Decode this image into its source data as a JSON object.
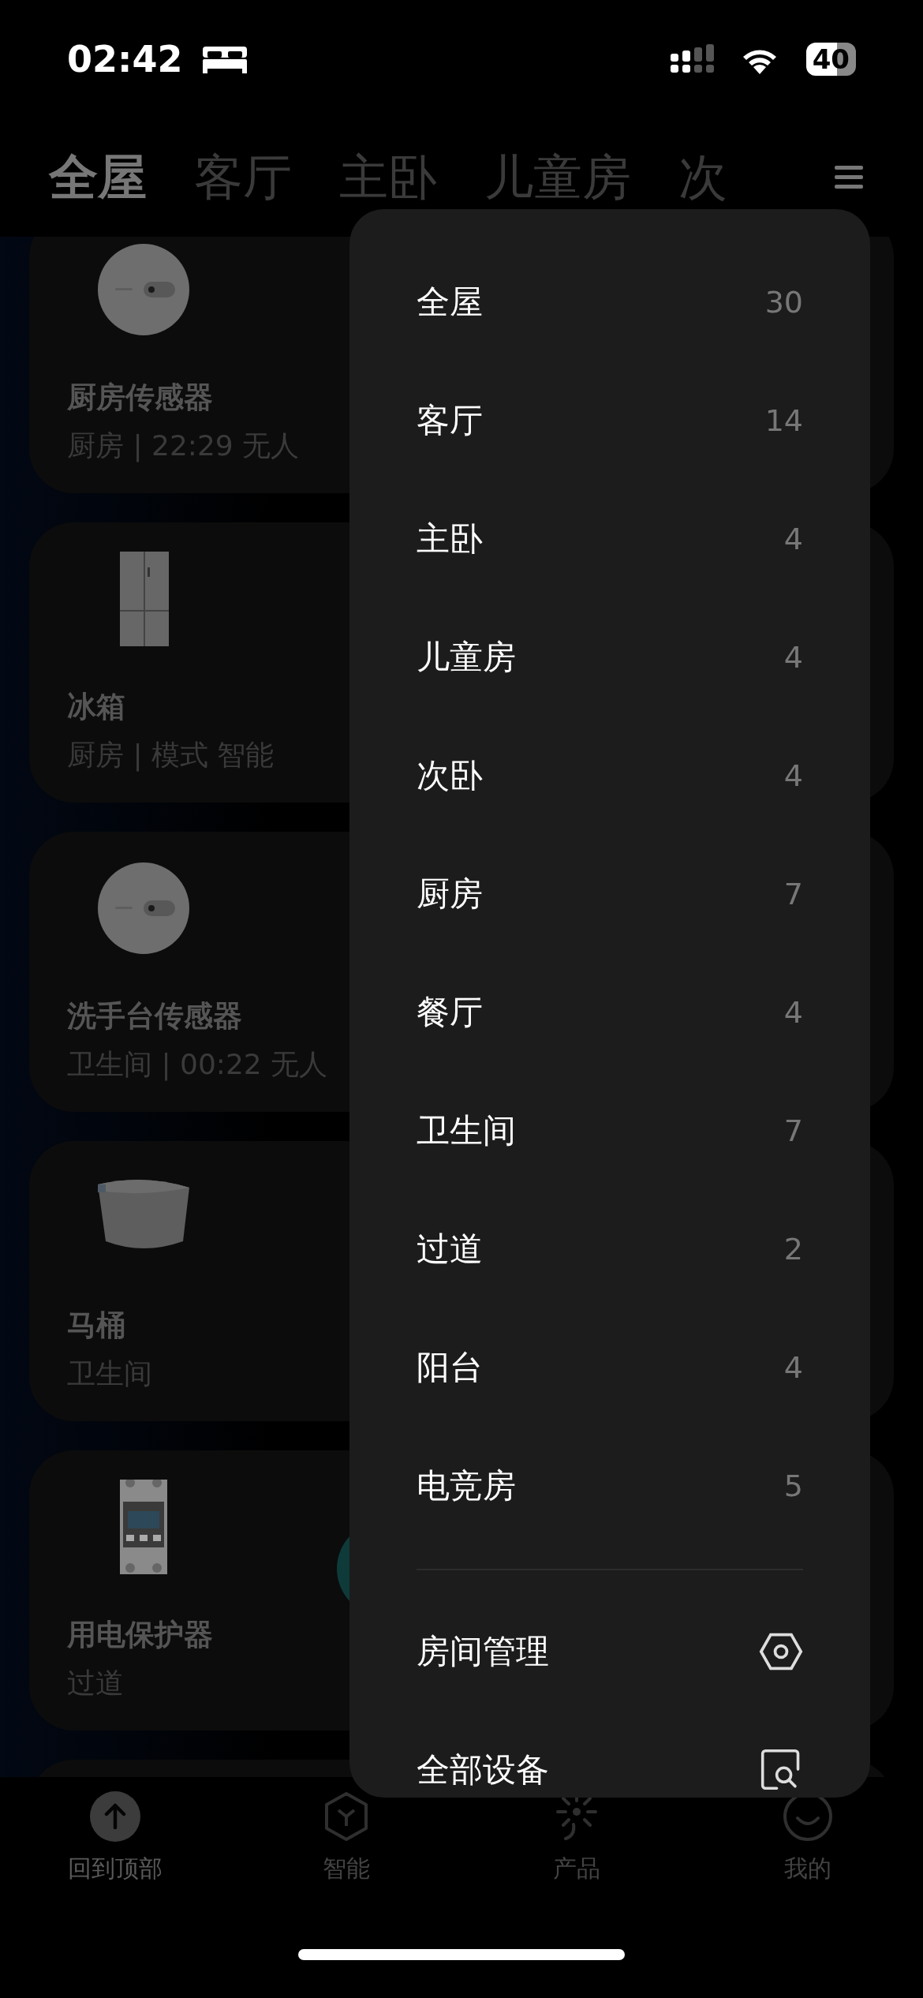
{
  "status_bar": {
    "time": "02:42",
    "battery": "40"
  },
  "tabs": [
    {
      "label": "全屋",
      "selected": true
    },
    {
      "label": "客厅",
      "selected": false
    },
    {
      "label": "主卧",
      "selected": false
    },
    {
      "label": "儿童房",
      "selected": false
    },
    {
      "label": "次",
      "selected": false
    }
  ],
  "devices": [
    {
      "name": "厨房传感器",
      "subtitle": "厨房 | 22:29 无人",
      "kind": "sensor",
      "has_button": false
    },
    {
      "name": "冰箱",
      "subtitle": "厨房 | 模式 智能",
      "kind": "fridge",
      "has_button": false
    },
    {
      "name": "洗手台传感器",
      "subtitle": "卫生间 | 00:22 无人",
      "kind": "sensor",
      "has_button": false
    },
    {
      "name": "马桶",
      "subtitle": "卫生间",
      "kind": "toilet",
      "has_button": false
    },
    {
      "name": "用电保护器",
      "subtitle": "过道",
      "kind": "breaker",
      "has_button": true
    }
  ],
  "room_menu": {
    "rooms": [
      {
        "name": "全屋",
        "count": "30"
      },
      {
        "name": "客厅",
        "count": "14"
      },
      {
        "name": "主卧",
        "count": "4"
      },
      {
        "name": "儿童房",
        "count": "4"
      },
      {
        "name": "次卧",
        "count": "4"
      },
      {
        "name": "厨房",
        "count": "7"
      },
      {
        "name": "餐厅",
        "count": "4"
      },
      {
        "name": "卫生间",
        "count": "7"
      },
      {
        "name": "过道",
        "count": "2"
      },
      {
        "name": "阳台",
        "count": "4"
      },
      {
        "name": "电竞房",
        "count": "5"
      }
    ],
    "actions": [
      {
        "label": "房间管理",
        "kind": "settings"
      },
      {
        "label": "全部设备",
        "kind": "search"
      }
    ]
  },
  "bottom_nav": [
    {
      "label": "回到顶部",
      "kind": "top"
    },
    {
      "label": "智能",
      "kind": "smart"
    },
    {
      "label": "产品",
      "kind": "product"
    },
    {
      "label": "我的",
      "kind": "me"
    }
  ]
}
